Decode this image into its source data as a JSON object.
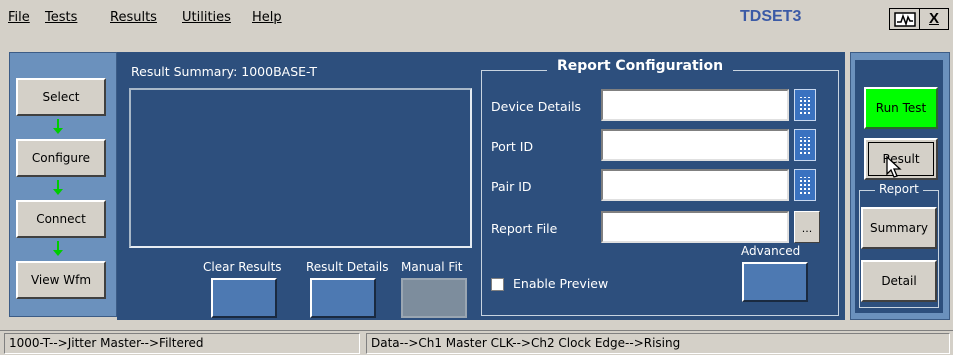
{
  "menu": {
    "file": "File",
    "tests": "Tests",
    "results": "Results",
    "utilities": "Utilities",
    "help": "Help",
    "app_title": "TDSET3",
    "close_label": "X"
  },
  "nav": {
    "select": "Select",
    "configure": "Configure",
    "connect": "Connect",
    "view_wfm": "View Wfm"
  },
  "results_panel": {
    "title": "Result Summary: 1000BASE-T",
    "clear_results": "Clear Results",
    "result_details": "Result Details",
    "manual_fit": "Manual Fit"
  },
  "report_config": {
    "title": "Report Configuration",
    "device_details_label": "Device Details",
    "device_details_value": "",
    "port_id_label": "Port ID",
    "port_id_value": "",
    "pair_id_label": "Pair ID",
    "pair_id_value": "",
    "report_file_label": "Report File",
    "report_file_value": "",
    "browse": "...",
    "advanced": "Advanced",
    "enable_preview": "Enable Preview",
    "enable_preview_checked": false
  },
  "right_panel": {
    "run_test": "Run Test",
    "result": "Result",
    "report_group": "Report",
    "summary": "Summary",
    "detail": "Detail"
  },
  "status": {
    "left": "1000-T-->Jitter Master-->Filtered",
    "right": "Data-->Ch1   Master CLK-->Ch2   Clock Edge-->Rising"
  },
  "colors": {
    "panel_dark": "#2d4f7d",
    "panel_light": "#6b91bd",
    "run_button": "#00ff00",
    "title_blue": "#3b5aa6",
    "arrow_green": "#00cc00"
  }
}
